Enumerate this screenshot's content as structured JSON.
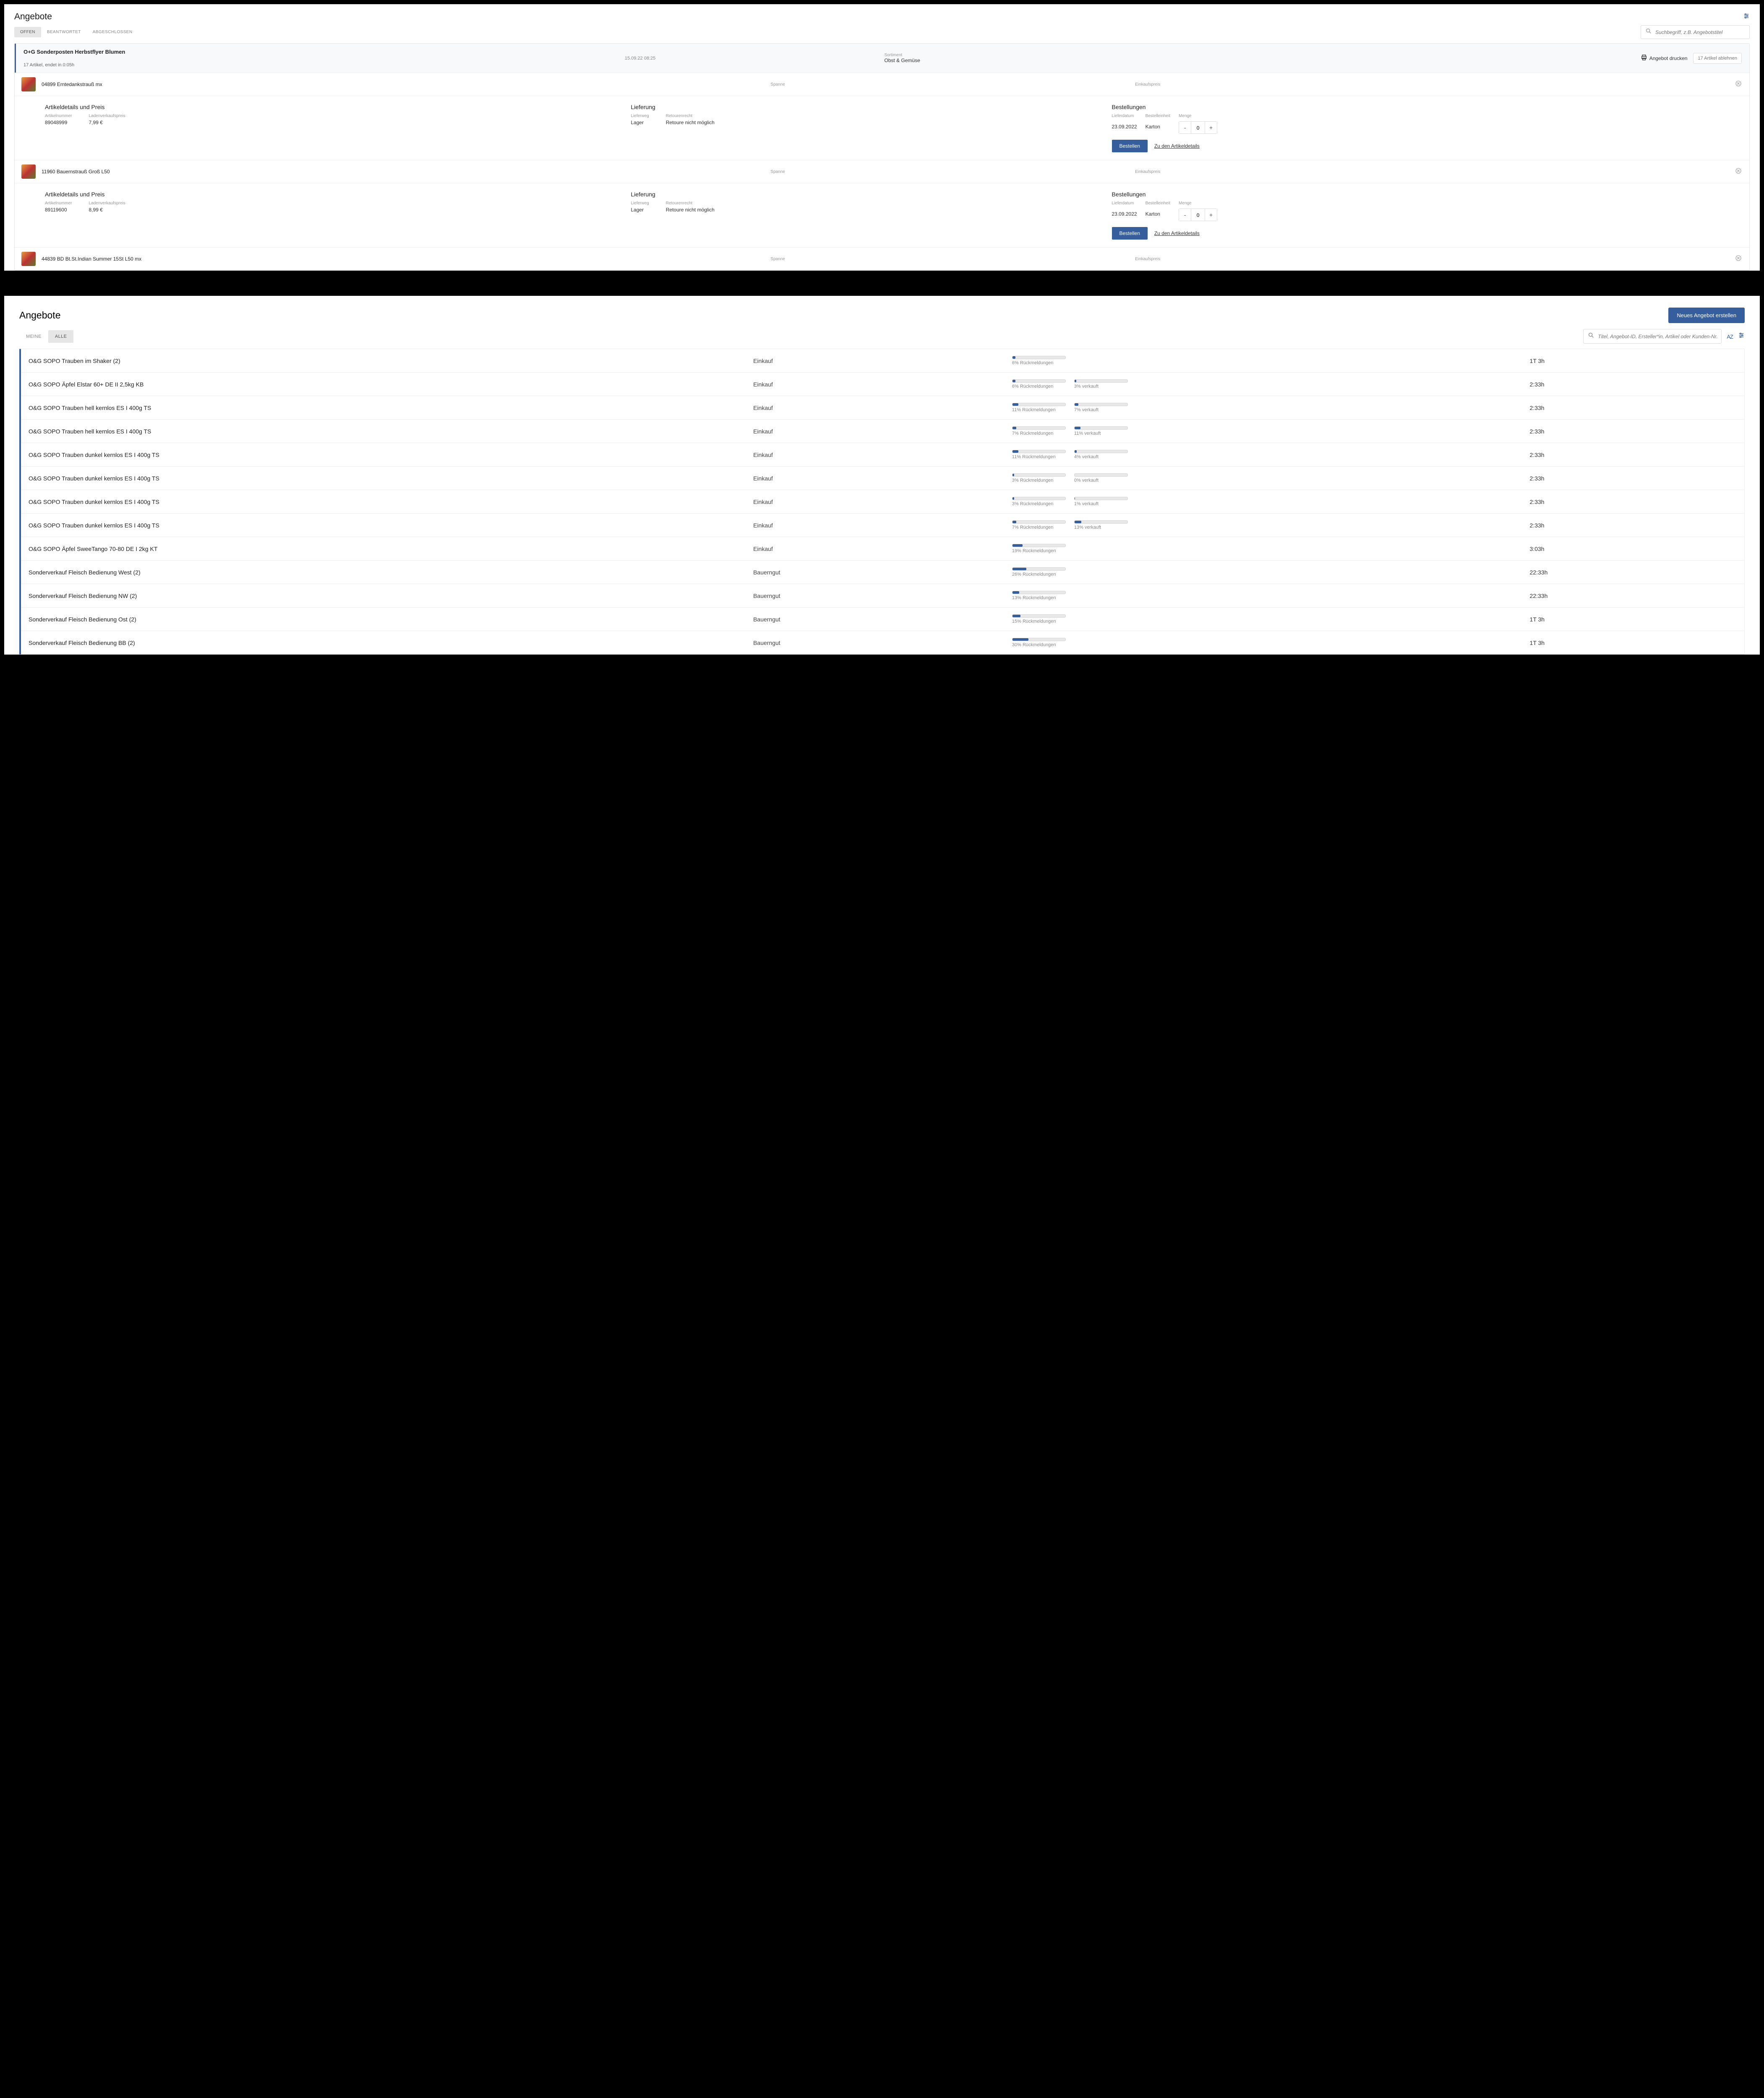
{
  "colors": {
    "accent": "#365e9d"
  },
  "screen1": {
    "title": "Angebote",
    "tabs": {
      "offen": "OFFEN",
      "beantwortet": "BEANTWORTET",
      "abgeschlossen": "ABGESCHLOSSEN"
    },
    "search_placeholder": "Suchbegriff, z.B. Angebotstitel",
    "offer": {
      "title": "O+G Sonderposten Herbstflyer Blumen",
      "meta": "17 Artikel, endet in 0:05h",
      "timestamp": "15.09.22 08:25",
      "sortiment_label": "Sortiment",
      "sortiment_value": "Obst & Gemüse",
      "print_label": "Angebot drucken",
      "reject_label": "17 Artikel ablehnen"
    },
    "labels": {
      "spanne": "Spanne",
      "einkaufspreis": "Einkaufspreis",
      "details_title": "Artikeldetails und Preis",
      "lieferung_title": "Lieferung",
      "bestellungen_title": "Bestellungen",
      "artikelnummer": "Artikelnummer",
      "ladenverkaufspreis": "Ladenverkaufspreis",
      "lieferweg": "Lieferweg",
      "retourenrecht": "Retourenrecht",
      "lieferdatum": "Lieferdatum",
      "bestelleinheit": "Bestelleinheit",
      "menge": "Menge",
      "bestellen": "Bestellen",
      "zu_details": "Zu den Artikeldetails"
    },
    "articles": [
      {
        "name": "04899 Erntedankstrauß mx",
        "artikelnummer": "89048999",
        "preis": "7,99 €",
        "lieferweg": "Lager",
        "retourenrecht": "Retoure nicht möglich",
        "lieferdatum": "23.09.2022",
        "bestelleinheit": "Karton",
        "menge": "0"
      },
      {
        "name": "11960 Bauernstrauß Groß L50",
        "artikelnummer": "89119600",
        "preis": "8,99 €",
        "lieferweg": "Lager",
        "retourenrecht": "Retoure nicht möglich",
        "lieferdatum": "23.09.2022",
        "bestelleinheit": "Karton",
        "menge": "0"
      },
      {
        "name": "44839 BD Bt.St.Indian Summer 15St L50 mx"
      }
    ]
  },
  "screen2": {
    "title": "Angebote",
    "create_button": "Neues Angebot erstellen",
    "tabs": {
      "meine": "MEINE",
      "alle": "ALLE"
    },
    "search_placeholder": "Titel, Angebot-ID, Ersteller*in, Artikel oder Kunden-Nr.",
    "sort_label": "AZ",
    "rows": [
      {
        "title": "O&G SOPO Trauben im Shaker (2)",
        "type": "Einkauf",
        "rueck_pct": 6,
        "rueck_label": "6% Rückmeldungen",
        "verkauft_pct": null,
        "verkauft_label": "",
        "time": "1T 3h"
      },
      {
        "title": "O&G SOPO Äpfel Elstar 60+ DE II 2,5kg KB",
        "type": "Einkauf",
        "rueck_pct": 6,
        "rueck_label": "6% Rückmeldungen",
        "verkauft_pct": 3,
        "verkauft_label": "3% verkauft",
        "time": "2:33h"
      },
      {
        "title": "O&G SOPO Trauben hell kernlos ES I 400g TS",
        "type": "Einkauf",
        "rueck_pct": 11,
        "rueck_label": "11% Rückmeldungen",
        "verkauft_pct": 7,
        "verkauft_label": "7% verkauft",
        "time": "2:33h"
      },
      {
        "title": "O&G SOPO Trauben hell kernlos ES I 400g TS",
        "type": "Einkauf",
        "rueck_pct": 7,
        "rueck_label": "7% Rückmeldungen",
        "verkauft_pct": 11,
        "verkauft_label": "11% verkauft",
        "time": "2:33h"
      },
      {
        "title": "O&G SOPO Trauben dunkel kernlos ES I 400g TS",
        "type": "Einkauf",
        "rueck_pct": 11,
        "rueck_label": "11% Rückmeldungen",
        "verkauft_pct": 4,
        "verkauft_label": "4% verkauft",
        "time": "2:33h"
      },
      {
        "title": "O&G SOPO Trauben dunkel kernlos ES I 400g TS",
        "type": "Einkauf",
        "rueck_pct": 3,
        "rueck_label": "3% Rückmeldungen",
        "verkauft_pct": 0,
        "verkauft_label": "0% verkauft",
        "time": "2:33h"
      },
      {
        "title": "O&G SOPO Trauben dunkel kernlos ES I 400g TS",
        "type": "Einkauf",
        "rueck_pct": 3,
        "rueck_label": "3% Rückmeldungen",
        "verkauft_pct": 1,
        "verkauft_label": "1% verkauft",
        "time": "2:33h"
      },
      {
        "title": "O&G SOPO Trauben dunkel kernlos ES I 400g TS",
        "type": "Einkauf",
        "rueck_pct": 7,
        "rueck_label": "7% Rückmeldungen",
        "verkauft_pct": 13,
        "verkauft_label": "13% verkauft",
        "time": "2:33h"
      },
      {
        "title": "O&G SOPO Äpfel SweeTango 70-80 DE I 2kg KT",
        "type": "Einkauf",
        "rueck_pct": 19,
        "rueck_label": "19% Rückmeldungen",
        "verkauft_pct": null,
        "verkauft_label": "",
        "time": "3:03h"
      },
      {
        "title": "Sonderverkauf Fleisch Bedienung West (2)",
        "type": "Bauerngut",
        "rueck_pct": 26,
        "rueck_label": "26% Rückmeldungen",
        "verkauft_pct": null,
        "verkauft_label": "",
        "time": "22:33h"
      },
      {
        "title": "Sonderverkauf Fleisch Bedienung NW (2)",
        "type": "Bauerngut",
        "rueck_pct": 13,
        "rueck_label": "13% Rückmeldungen",
        "verkauft_pct": null,
        "verkauft_label": "",
        "time": "22:33h"
      },
      {
        "title": "Sonderverkauf Fleisch Bedienung Ost (2)",
        "type": "Bauerngut",
        "rueck_pct": 15,
        "rueck_label": "15% Rückmeldungen",
        "verkauft_pct": null,
        "verkauft_label": "",
        "time": "1T 3h"
      },
      {
        "title": "Sonderverkauf Fleisch Bedienung BB (2)",
        "type": "Bauerngut",
        "rueck_pct": 30,
        "rueck_label": "30% Rückmeldungen",
        "verkauft_pct": null,
        "verkauft_label": "",
        "time": "1T 3h"
      }
    ]
  }
}
